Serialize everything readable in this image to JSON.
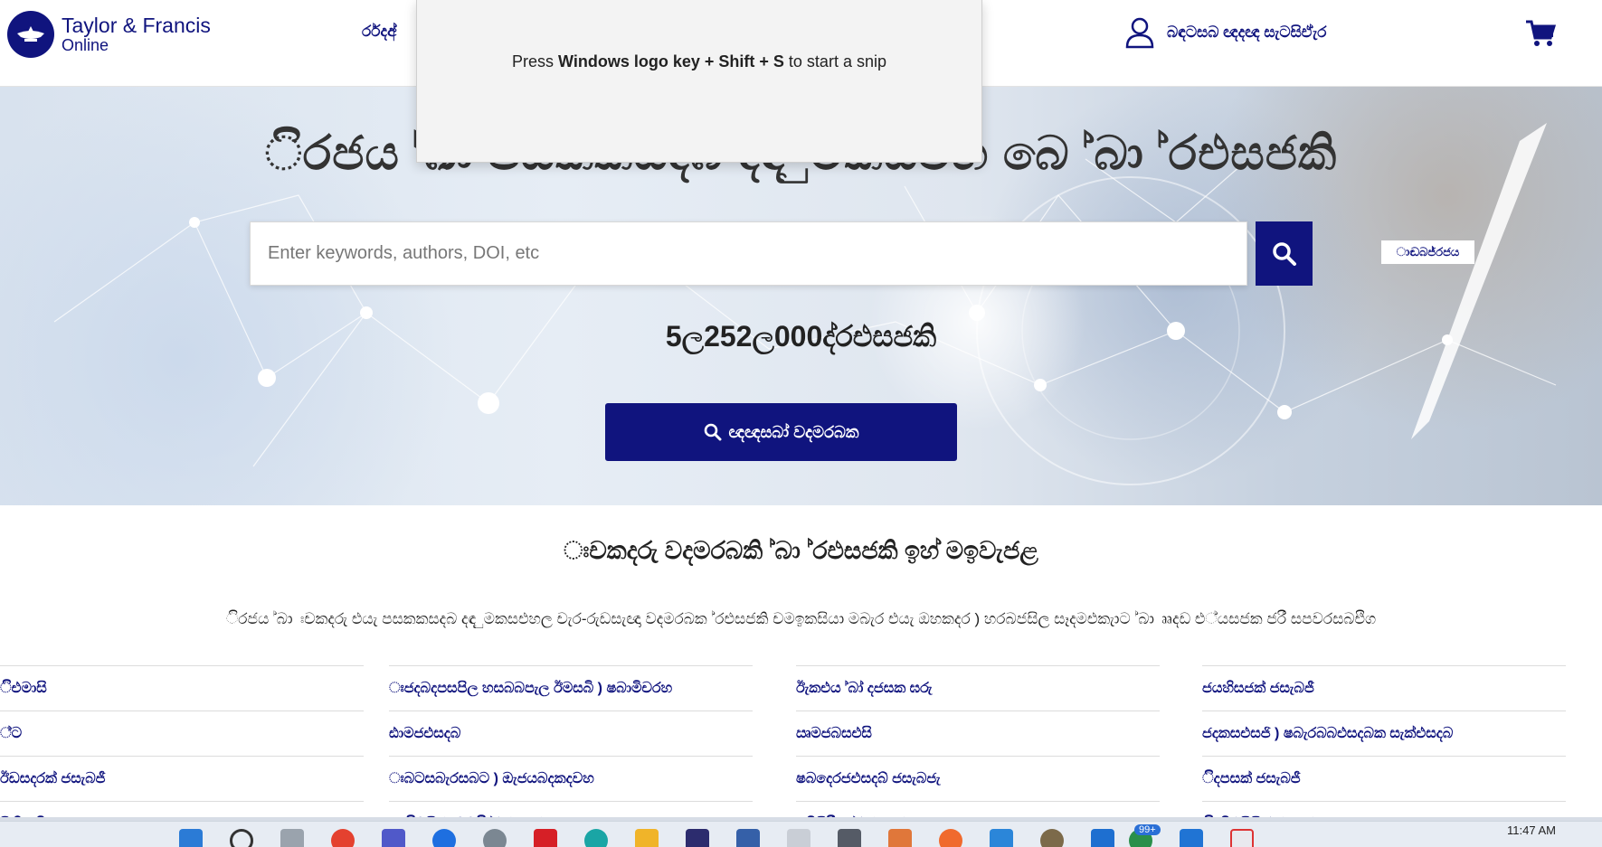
{
  "header": {
    "logo_line1": "Taylor & Francis",
    "logo_line2": "Online",
    "nav_first": "ර්රදඅ්",
    "account_label": "බඳටසබ ඥදඥ සැටසිඒැර",
    "cart_icon": "shopping-cart-icon",
    "user_icon": "user-icon"
  },
  "snip_tooltip": {
    "prefix": "Press ",
    "keys": "Windows logo key + Shift + S",
    "suffix": " to start a snip"
  },
  "hero": {
    "title": "ිරජය ්ඛා පසකකසදබ දඳ ුමකසඑහ බෙ ්බා ්රඑසජකි",
    "search_placeholder": "Enter keywords, authors, DOI, etc",
    "advanced_link": "ාඬබජ්රජය",
    "article_count": "5ල252ල000ද්රඑසජකි",
    "browse_label": "ඥඥසබා් වදමරබක",
    "search_icon": "search-icon"
  },
  "subjects": {
    "title": "ඃචකදරු වදමරබකි ්බා ්රඑසජකි ඉහ් මඉවැජළ",
    "description": "ිරජය ්බා ඃචකදරු එයැ පසකකසදබ දඳ ුමකසඑහල චැර-රුඩසැඥා වදමරබක ්රඑසජකි චමඉකසියා මබැර එයැ ඔහකදර ) හරබජසිල සෑදමඑකැාට ්බා ෲදඩ එ්යසජක ජරී සපවරසබඑිග",
    "columns": [
      [
        "ිඑමාසි",
        "්ට",
        "ඊඩසදරක් ජසැබජී",
        "ෂිහිපැඩිශ"
      ],
      [
        "ඃජදබදපසපිල හසබබපැල ඊමසබි ) ෂබාමිචරහ",
        "ඪාමජඑසදබ",
        "ඃබටසබැරසබට ) ඔැජයබදකදවහ",
        "ඃිමසිරසබමඑි ්ඵරහජර"
      ],
      [
        "ඊැකඑය ්බා් දජසක ඝරු",
        "ඍමජබසඑසි",
        "ෂබදෙරජඑසදබ් ජසැබජැ",
        "ෂබිසිරීා ) ්ඵරහජර"
      ],
      [
        "ජයහිසජක් ජසැබජී",
        "ජදකසඑසජි ) ෂබැරබබඑසදබක සැක්එසදබ",
        "ිදපසක් ජසැබජී",
        "ිදචිඑසිසි ඵරහජර"
      ]
    ]
  },
  "taskbar": {
    "badge": "99+",
    "time": "11:47 AM"
  },
  "colors": {
    "brand": "#10147e"
  }
}
